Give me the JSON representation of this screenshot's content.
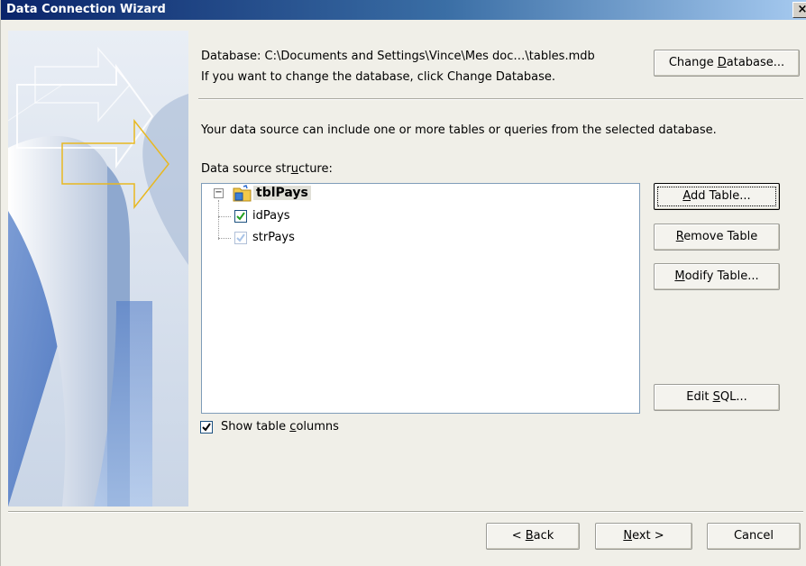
{
  "window": {
    "title": "Data Connection Wizard",
    "close_glyph": "×"
  },
  "database": {
    "label": "Database: C:\\Documents and Settings\\Vince\\Mes doc…\\tables.mdb",
    "hint": "If you want to change the database, click Change Database.",
    "change_button": {
      "pre": "Change ",
      "accel": "D",
      "post": "atabase..."
    }
  },
  "description": "Your data source can include one or more tables or queries from the selected database.",
  "structure_label": {
    "pre": "Data source str",
    "accel": "u",
    "post": "cture:"
  },
  "tree": {
    "table": "tblPays",
    "columns": [
      {
        "name": "idPays",
        "checked": true,
        "enabled": true
      },
      {
        "name": "strPays",
        "checked": true,
        "enabled": false
      }
    ]
  },
  "side_buttons": {
    "add": {
      "pre": "",
      "accel": "A",
      "post": "dd Table..."
    },
    "remove": {
      "pre": "",
      "accel": "R",
      "post": "emove Table"
    },
    "modify": {
      "pre": "",
      "accel": "M",
      "post": "odify Table..."
    },
    "edit_sql": {
      "pre": "Edit ",
      "accel": "S",
      "post": "QL..."
    }
  },
  "show_columns": {
    "checked": true,
    "pre": "Show table ",
    "accel": "c",
    "post": "olumns"
  },
  "nav": {
    "back": {
      "pre": "< ",
      "accel": "B",
      "post": "ack"
    },
    "next": {
      "pre": "",
      "accel": "N",
      "post": "ext >"
    },
    "cancel": "Cancel"
  },
  "colors": {
    "title_start": "#0a246a",
    "title_end": "#a6caf0",
    "dialog_bg": "#f0efe8",
    "banner_blue": "#5a7fc0",
    "arrow_gold": "#e8b820"
  }
}
